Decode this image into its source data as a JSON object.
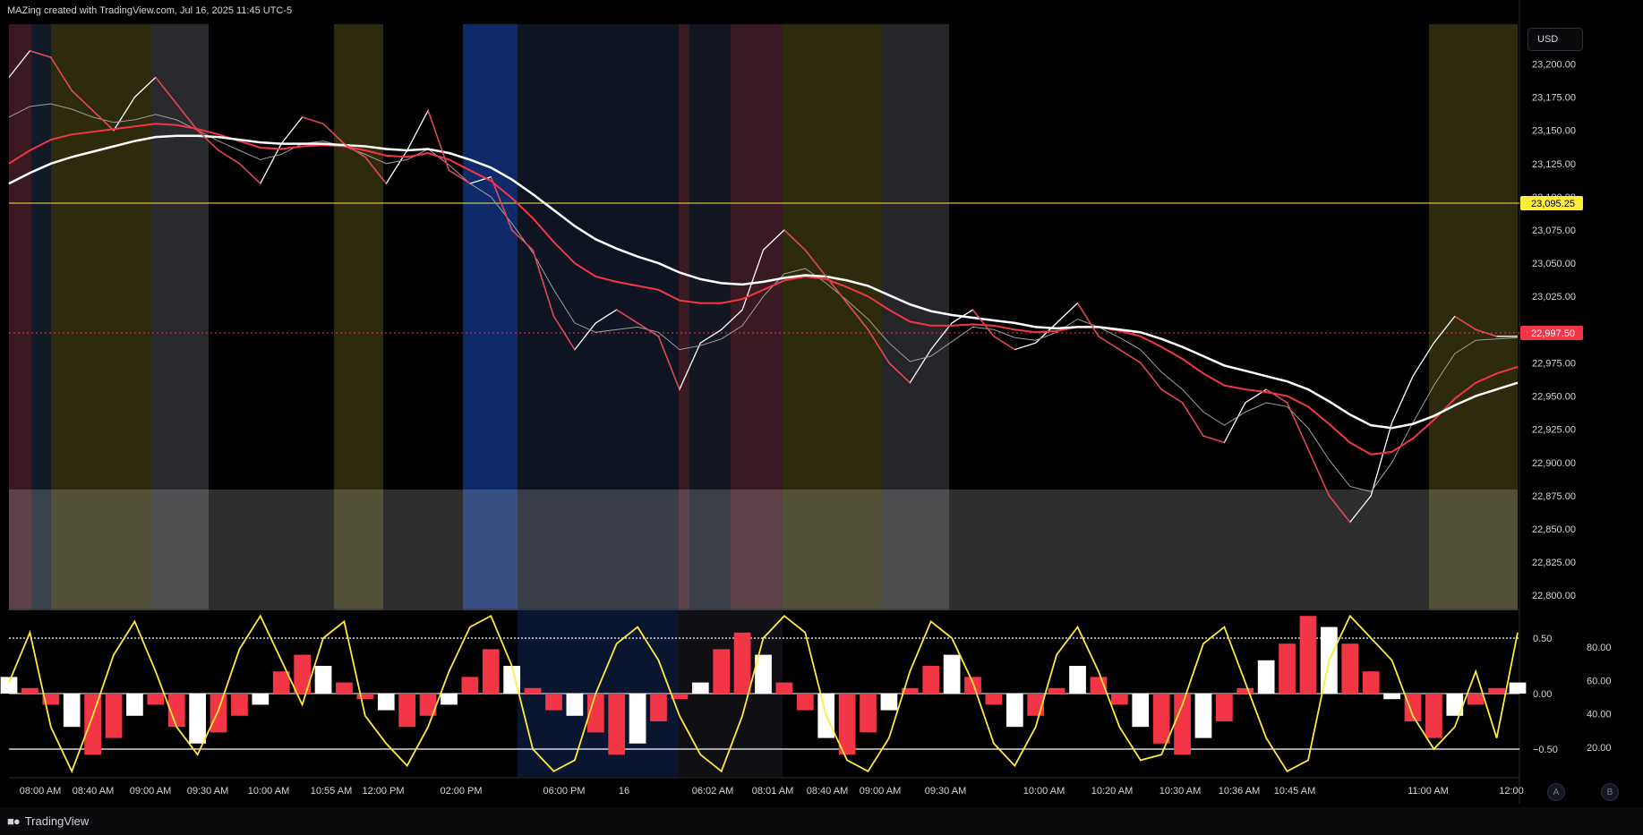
{
  "header": {
    "title": "MAZing created with TradingView.com, Jul 16, 2025 11:45 UTC-5"
  },
  "price_scale": {
    "currency": "USD",
    "ticks": [
      "23,200.00",
      "23,175.00",
      "23,150.00",
      "23,125.00",
      "23,100.00",
      "23,075.00",
      "23,050.00",
      "23,025.00",
      "23,000.00",
      "22,975.00",
      "22,950.00",
      "22,925.00",
      "22,900.00",
      "22,875.00",
      "22,850.00",
      "22,825.00",
      "22,800.00"
    ]
  },
  "osc_scale": {
    "left_ticks": [
      "0.50",
      "0.00",
      "−0.50"
    ],
    "right_ticks": [
      "80.00",
      "60.00",
      "40.00",
      "20.00"
    ]
  },
  "time_axis": [
    "08:00 AM",
    "08:40 AM",
    "09:00 AM",
    "09:30 AM",
    "10:00 AM",
    "10:55 AM",
    "12:00 PM",
    "02:00 PM",
    "06:00 PM",
    "16",
    "06:02 AM",
    "08:01 AM",
    "08:40 AM",
    "09:00 AM",
    "09:30 AM",
    "10:00 AM",
    "10:20 AM",
    "10:30 AM",
    "10:36 AM",
    "10:45 AM",
    "11:00 AM",
    "12:00"
  ],
  "footer": {
    "brand": "TradingView",
    "scale_buttons": [
      "A",
      "B"
    ]
  },
  "colors": {
    "bg": "#000000",
    "up_candle": "#ffffff",
    "down_candle": "#f23645",
    "yellow": "#ffeb3b",
    "red_ma": "#f23645"
  },
  "chart_data": {
    "type": "line",
    "title": "",
    "ylim": [
      22790,
      23230
    ],
    "horizontal_lines": [
      {
        "value": 23095.25,
        "label": "23,095.25",
        "color": "#ffeb3b",
        "style": "solid"
      },
      {
        "value": 22997.5,
        "label": "22,997.50",
        "color": "#f23645",
        "style": "dotted"
      }
    ],
    "x": [
      0,
      1,
      2,
      3,
      4,
      5,
      6,
      7,
      8,
      9,
      10,
      11,
      12,
      13,
      14,
      15,
      16,
      17,
      18,
      19,
      20,
      21,
      22,
      23,
      24,
      25,
      26,
      27,
      28,
      29,
      30,
      31,
      32,
      33,
      34,
      35,
      36,
      37,
      38,
      39,
      40,
      41,
      42,
      43,
      44,
      45,
      46,
      47,
      48,
      49,
      50,
      51,
      52,
      53,
      54,
      55,
      56,
      57,
      58,
      59,
      60,
      61,
      62,
      63,
      64,
      65,
      66,
      67,
      68,
      69,
      70,
      71,
      72
    ],
    "series": [
      {
        "values": [
          23190,
          23210,
          23205,
          23180,
          23165,
          23150,
          23175,
          23190,
          23170,
          23150,
          23135,
          23125,
          23110,
          23140,
          23160,
          23155,
          23140,
          23130,
          23110,
          23135,
          23165,
          23120,
          23110,
          23115,
          23075,
          23060,
          23010,
          22985,
          23005,
          23015,
          23005,
          22995,
          22955,
          22990,
          23000,
          23015,
          23060,
          23075,
          23060,
          23040,
          23020,
          23000,
          22975,
          22960,
          22985,
          23005,
          23015,
          22995,
          22985,
          22990,
          23005,
          23020,
          22995,
          22985,
          22975,
          22955,
          22945,
          22920,
          22915,
          22945,
          22955,
          22945,
          22910,
          22875,
          22855,
          22875,
          22930,
          22965,
          22990,
          23010,
          23000,
          22995,
          22995
        ]
      },
      {
        "values": [
          23160,
          23168,
          23170,
          23166,
          23160,
          23156,
          23158,
          23162,
          23158,
          23150,
          23142,
          23135,
          23128,
          23132,
          23140,
          23142,
          23138,
          23132,
          23125,
          23128,
          23136,
          23124,
          23110,
          23100,
          23080,
          23058,
          23030,
          23005,
          22998,
          23000,
          23002,
          22998,
          22985,
          22988,
          22993,
          23003,
          23025,
          23042,
          23046,
          23035,
          23022,
          23008,
          22990,
          22976,
          22980,
          22991,
          23002,
          23000,
          22994,
          22992,
          22998,
          23008,
          23002,
          22994,
          22985,
          22968,
          22955,
          22938,
          22928,
          22938,
          22945,
          22942,
          22926,
          22902,
          22882,
          22878,
          22900,
          22930,
          22958,
          22982,
          22992,
          22993,
          22994
        ]
      },
      {
        "values": [
          23125,
          23135,
          23143,
          23147,
          23149,
          23151,
          23153,
          23155,
          23154,
          23151,
          23147,
          23142,
          23137,
          23136,
          23138,
          23139,
          23138,
          23135,
          23131,
          23130,
          23133,
          23128,
          23120,
          23112,
          23099,
          23084,
          23066,
          23050,
          23040,
          23036,
          23033,
          23030,
          23022,
          23020,
          23020,
          23023,
          23030,
          23037,
          23040,
          23038,
          23032,
          23025,
          23015,
          23006,
          23003,
          23003,
          23004,
          23003,
          23000,
          22998,
          22999,
          23002,
          23002,
          22999,
          22995,
          22987,
          22978,
          22967,
          22958,
          22955,
          22953,
          22950,
          22942,
          22929,
          22915,
          22906,
          22908,
          22918,
          22932,
          22948,
          22960,
          22967,
          22972
        ]
      },
      {
        "values": [
          23110,
          23118,
          23125,
          23130,
          23134,
          23138,
          23142,
          23145,
          23146,
          23146,
          23145,
          23143,
          23141,
          23140,
          23140,
          23140,
          23139,
          23138,
          23136,
          23135,
          23136,
          23133,
          23128,
          23122,
          23113,
          23102,
          23090,
          23078,
          23068,
          23061,
          23055,
          23050,
          23043,
          23038,
          23035,
          23034,
          23036,
          23039,
          23041,
          23040,
          23037,
          23033,
          23026,
          23019,
          23014,
          23011,
          23009,
          23007,
          23005,
          23002,
          23001,
          23002,
          23002,
          23000,
          22998,
          22993,
          22987,
          22980,
          22973,
          22969,
          22965,
          22961,
          22955,
          22946,
          22936,
          22928,
          22926,
          22929,
          22935,
          22943,
          22950,
          22955,
          22960
        ]
      }
    ],
    "oscillator": {
      "ylim": [
        -0.75,
        0.75
      ],
      "zero_line": 0.0,
      "levels": [
        0.5,
        -0.5
      ],
      "histogram": [
        0.15,
        0.05,
        -0.1,
        -0.3,
        -0.55,
        -0.4,
        -0.2,
        -0.1,
        -0.3,
        -0.45,
        -0.35,
        -0.2,
        -0.1,
        0.2,
        0.35,
        0.25,
        0.1,
        -0.05,
        -0.15,
        -0.3,
        -0.2,
        -0.1,
        0.15,
        0.4,
        0.25,
        0.05,
        -0.15,
        -0.2,
        -0.35,
        -0.55,
        -0.45,
        -0.25,
        -0.05,
        0.1,
        0.4,
        0.55,
        0.35,
        0.1,
        -0.15,
        -0.4,
        -0.55,
        -0.35,
        -0.15,
        0.05,
        0.25,
        0.35,
        0.15,
        -0.1,
        -0.3,
        -0.2,
        0.05,
        0.25,
        0.15,
        -0.1,
        -0.3,
        -0.45,
        -0.55,
        -0.4,
        -0.25,
        0.05,
        0.3,
        0.45,
        0.7,
        0.6,
        0.45,
        0.2,
        -0.05,
        -0.25,
        -0.4,
        -0.2,
        -0.1,
        0.05,
        0.1
      ],
      "signal": [
        0.1,
        0.55,
        -0.3,
        -0.7,
        -0.2,
        0.35,
        0.65,
        0.2,
        -0.3,
        -0.55,
        -0.15,
        0.4,
        0.7,
        0.3,
        -0.1,
        0.5,
        0.65,
        -0.2,
        -0.45,
        -0.65,
        -0.3,
        0.2,
        0.6,
        0.7,
        0.25,
        -0.5,
        -0.7,
        -0.6,
        0.0,
        0.45,
        0.6,
        0.3,
        -0.2,
        -0.55,
        -0.7,
        -0.2,
        0.5,
        0.7,
        0.55,
        -0.2,
        -0.6,
        -0.7,
        -0.4,
        0.2,
        0.65,
        0.5,
        0.1,
        -0.45,
        -0.65,
        -0.3,
        0.35,
        0.6,
        0.2,
        -0.3,
        -0.6,
        -0.55,
        -0.1,
        0.45,
        0.6,
        0.1,
        -0.4,
        -0.7,
        -0.6,
        0.3,
        0.7,
        0.5,
        0.3,
        -0.2,
        -0.5,
        -0.3,
        0.2,
        -0.4,
        0.55
      ]
    }
  }
}
